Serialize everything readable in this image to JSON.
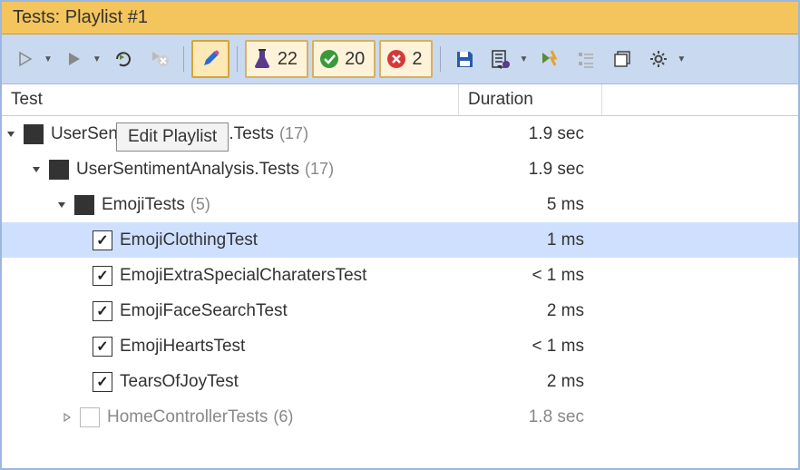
{
  "window": {
    "title": "Tests: Playlist #1"
  },
  "toolbar": {
    "stats": {
      "total": "22",
      "passed": "20",
      "failed": "2"
    },
    "tooltip": "Edit Playlist"
  },
  "columns": {
    "test": "Test",
    "duration": "Duration"
  },
  "tree": [
    {
      "indent": 0,
      "expander": "open",
      "check": "full",
      "label": "UserSentimentAnalysis.Tests",
      "count": "(17)",
      "duration": "1.9 sec",
      "dim": false,
      "selected": false
    },
    {
      "indent": 1,
      "expander": "open",
      "check": "full",
      "label": "UserSentimentAnalysis.Tests",
      "count": "(17)",
      "duration": "1.9 sec",
      "dim": false,
      "selected": false
    },
    {
      "indent": 2,
      "expander": "open",
      "check": "full",
      "label": "EmojiTests",
      "count": "(5)",
      "duration": "5 ms",
      "dim": false,
      "selected": false
    },
    {
      "indent": 3,
      "expander": "",
      "check": "check",
      "label": "EmojiClothingTest",
      "count": "",
      "duration": "1 ms",
      "dim": false,
      "selected": true
    },
    {
      "indent": 3,
      "expander": "",
      "check": "check",
      "label": "EmojiExtraSpecialCharatersTest",
      "count": "",
      "duration": "< 1 ms",
      "dim": false,
      "selected": false
    },
    {
      "indent": 3,
      "expander": "",
      "check": "check",
      "label": "EmojiFaceSearchTest",
      "count": "",
      "duration": "2 ms",
      "dim": false,
      "selected": false
    },
    {
      "indent": 3,
      "expander": "",
      "check": "check",
      "label": "EmojiHeartsTest",
      "count": "",
      "duration": "< 1 ms",
      "dim": false,
      "selected": false
    },
    {
      "indent": 3,
      "expander": "",
      "check": "check",
      "label": "TearsOfJoyTest",
      "count": "",
      "duration": "2 ms",
      "dim": false,
      "selected": false
    },
    {
      "indent": 2,
      "expander": "closed",
      "check": "empty",
      "label": "HomeControllerTests",
      "count": "(6)",
      "duration": "1.8 sec",
      "dim": true,
      "selected": false
    }
  ]
}
